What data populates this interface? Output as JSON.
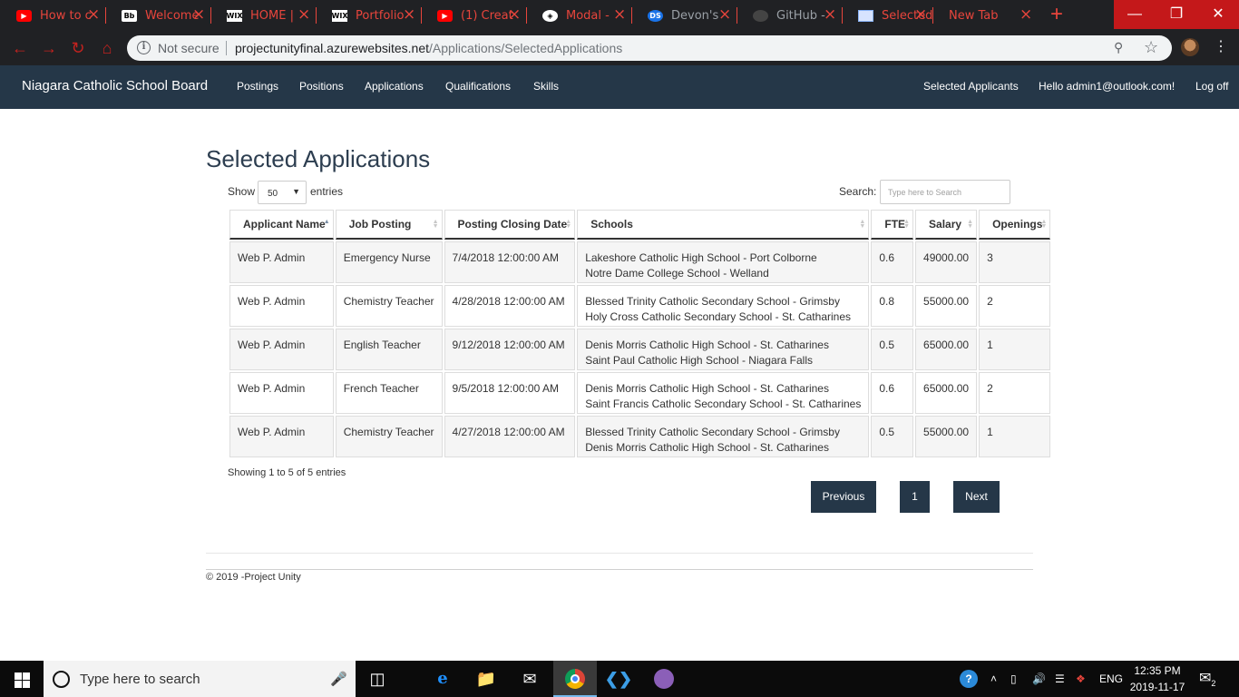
{
  "browser": {
    "tabs": [
      {
        "title": "How to c",
        "favicon": "youtube-icon",
        "favicon_text": "▶"
      },
      {
        "title": "Welcome",
        "favicon": "blackboard-icon",
        "favicon_text": "Bb"
      },
      {
        "title": "HOME |",
        "favicon": "wix-icon",
        "favicon_text": "WIX"
      },
      {
        "title": "Portfolio",
        "favicon": "wix-icon",
        "favicon_text": "WIX"
      },
      {
        "title": "(1) Creat",
        "favicon": "youtube-icon",
        "favicon_text": "▶"
      },
      {
        "title": "Modal -",
        "favicon": "codepen-icon",
        "favicon_text": "◈"
      },
      {
        "title": "Devon's",
        "favicon": "ds-icon",
        "favicon_text": "DS"
      },
      {
        "title": "GitHub -",
        "favicon": "github-icon",
        "favicon_text": ""
      },
      {
        "title": "Selected",
        "favicon": "document-icon",
        "favicon_text": ""
      },
      {
        "title": "New Tab",
        "favicon": "",
        "favicon_text": ""
      }
    ],
    "address": {
      "security": "Not secure",
      "host": "projectunityfinal.azurewebsites.net",
      "path": "/Applications/SelectedApplications"
    }
  },
  "navbar": {
    "brand": "Niagara Catholic School Board",
    "links": [
      "Postings",
      "Positions",
      "Applications",
      "Qualifications",
      "Skills"
    ],
    "right": {
      "selected_applicants": "Selected Applicants",
      "greeting": "Hello admin1@outlook.com!",
      "logoff": "Log off"
    }
  },
  "page": {
    "title": "Selected Applications",
    "length_control": {
      "show_label": "Show",
      "value": "50",
      "entries_label": "entries"
    },
    "search": {
      "label": "Search:",
      "placeholder": "Type here to Search"
    },
    "table": {
      "columns": [
        "Applicant Name",
        "Job Posting",
        "Posting Closing Date",
        "Schools",
        "FTE",
        "Salary",
        "Openings"
      ],
      "rows": [
        {
          "applicant": "Web P. Admin",
          "job": "Emergency Nurse",
          "closing": "7/4/2018 12:00:00 AM",
          "schools": [
            "Lakeshore Catholic High School - Port Colborne",
            "Notre Dame College School - Welland"
          ],
          "fte": "0.6",
          "salary": "49000.00",
          "openings": "3"
        },
        {
          "applicant": "Web P. Admin",
          "job": "Chemistry Teacher",
          "closing": "4/28/2018 12:00:00 AM",
          "schools": [
            "Blessed Trinity Catholic Secondary School - Grimsby",
            "Holy Cross Catholic Secondary School - St. Catharines"
          ],
          "fte": "0.8",
          "salary": "55000.00",
          "openings": "2"
        },
        {
          "applicant": "Web P. Admin",
          "job": "English Teacher",
          "closing": "9/12/2018 12:00:00 AM",
          "schools": [
            "Denis Morris Catholic High School - St. Catharines",
            "Saint Paul Catholic High School - Niagara Falls"
          ],
          "fte": "0.5",
          "salary": "65000.00",
          "openings": "1"
        },
        {
          "applicant": "Web P. Admin",
          "job": "French Teacher",
          "closing": "9/5/2018 12:00:00 AM",
          "schools": [
            "Denis Morris Catholic High School - St. Catharines",
            "Saint Francis Catholic Secondary School - St. Catharines"
          ],
          "fte": "0.6",
          "salary": "65000.00",
          "openings": "2"
        },
        {
          "applicant": "Web P. Admin",
          "job": "Chemistry Teacher",
          "closing": "4/27/2018 12:00:00 AM",
          "schools": [
            "Blessed Trinity Catholic Secondary School - Grimsby",
            "Denis Morris Catholic High School - St. Catharines"
          ],
          "fte": "0.5",
          "salary": "55000.00",
          "openings": "1"
        }
      ]
    },
    "info": "Showing 1 to 5 of 5 entries",
    "pagination": {
      "previous": "Previous",
      "current": "1",
      "next": "Next"
    },
    "footer": "© 2019 -Project Unity"
  },
  "taskbar": {
    "search_placeholder": "Type here to search",
    "language": "ENG",
    "time": "12:35 PM",
    "date": "2019-11-17",
    "notification_count": "2"
  },
  "colors": {
    "navbar_bg": "#253748",
    "title_color": "#2d3e50",
    "tab_accent": "#e8453c",
    "chrome_dark": "#202124"
  }
}
